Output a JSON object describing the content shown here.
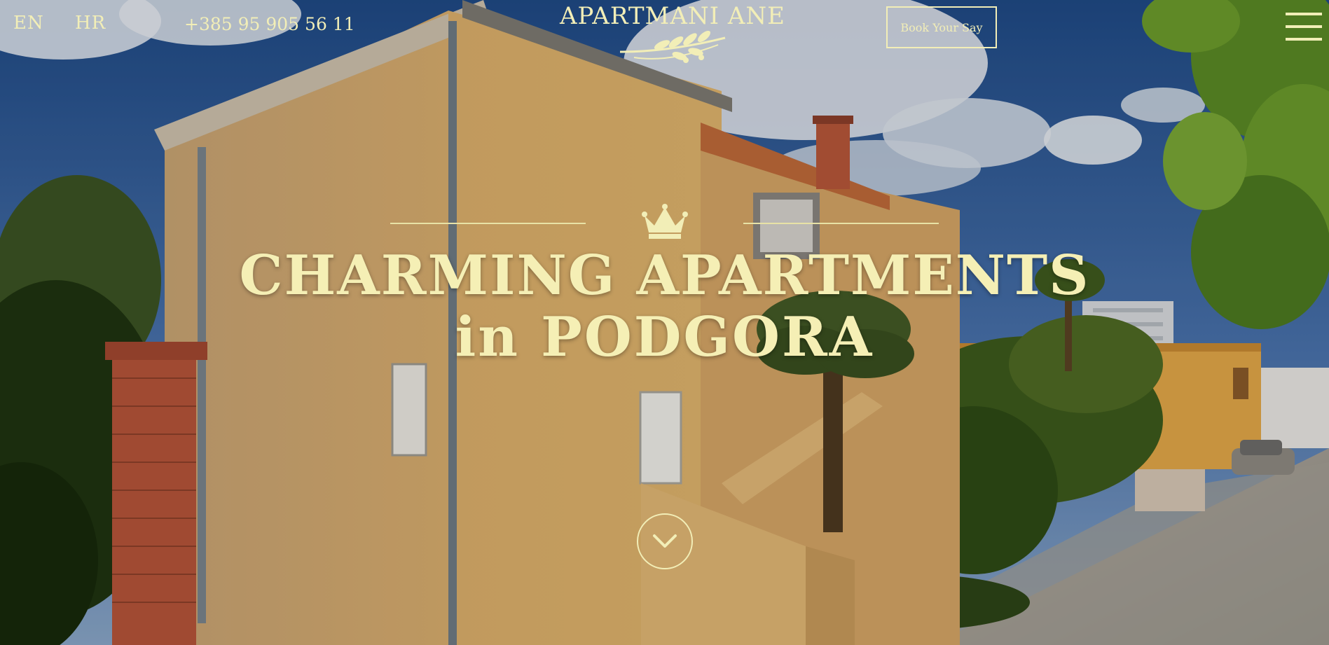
{
  "nav": {
    "lang_en": "EN",
    "lang_hr": "HR",
    "phone": "+385 95 905 56 11",
    "logo_text": "APARTMANI ANE",
    "book_label": "Book Your Say"
  },
  "hero": {
    "headline_line1": "CHARMING APARTMENTS",
    "headline_line2": "in PODGORA"
  },
  "icons": {
    "logo": "olive-branch-icon",
    "crown": "crown-icon",
    "menu": "hamburger-menu-icon",
    "scroll": "chevron-down-icon"
  },
  "colors": {
    "accent": "#f2eeb7",
    "headline": "#f5efb5",
    "sky": "#2d5590",
    "facade": "#d9a962"
  }
}
